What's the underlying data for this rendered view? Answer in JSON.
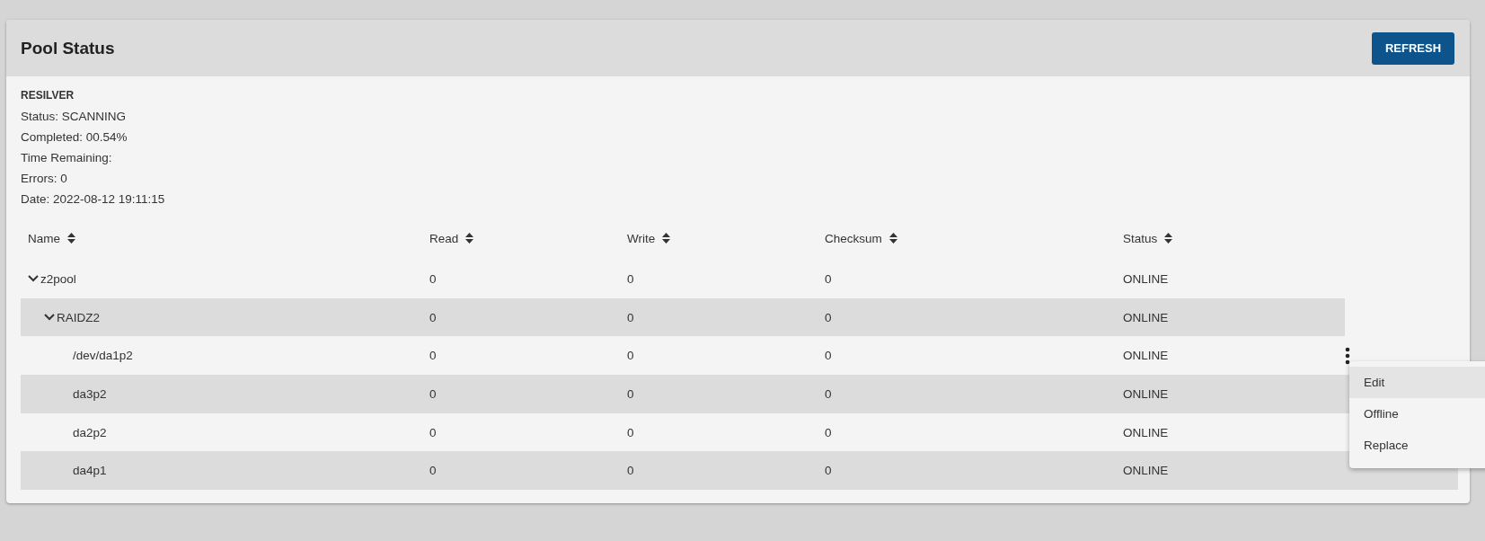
{
  "title": "Pool Status",
  "refresh_button": "REFRESH",
  "scan": {
    "heading": "RESILVER",
    "lines": [
      "Status: SCANNING",
      "Completed: 00.54%",
      "Time Remaining:",
      "Errors: 0",
      "Date: 2022-08-12 19:11:15"
    ]
  },
  "table": {
    "columns": [
      "Name",
      "Read",
      "Write",
      "Checksum",
      "Status"
    ],
    "rows": [
      {
        "kind": "pool",
        "name": "z2pool",
        "expanded": true,
        "read": "0",
        "write": "0",
        "checksum": "0",
        "status": "ONLINE",
        "children": [
          {
            "kind": "vdev",
            "name": "RAIDZ2",
            "expanded": true,
            "read": "0",
            "write": "0",
            "checksum": "0",
            "status": "ONLINE",
            "children": [
              {
                "kind": "disk",
                "name": "/dev/da1p2",
                "read": "0",
                "write": "0",
                "checksum": "0",
                "status": "ONLINE",
                "menu_open": true
              },
              {
                "kind": "disk",
                "name": "da3p2",
                "read": "0",
                "write": "0",
                "checksum": "0",
                "status": "ONLINE",
                "menu_open": false
              },
              {
                "kind": "disk",
                "name": "da2p2",
                "read": "0",
                "write": "0",
                "checksum": "0",
                "status": "ONLINE",
                "menu_open": false
              },
              {
                "kind": "disk",
                "name": "da4p1",
                "read": "0",
                "write": "0",
                "checksum": "0",
                "status": "ONLINE",
                "menu_open": false
              }
            ]
          }
        ]
      }
    ]
  },
  "menu": [
    {
      "label": "Edit",
      "selected": true
    },
    {
      "label": "Offline",
      "selected": false
    },
    {
      "label": "Replace",
      "selected": false
    }
  ]
}
